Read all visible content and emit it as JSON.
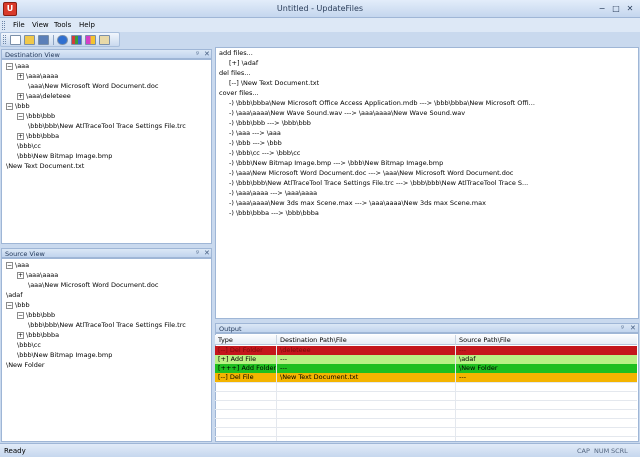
{
  "window": {
    "app_icon": "U",
    "title": "Untitled - UpdateFiles",
    "minimize": "−",
    "maximize": "□",
    "close": "✕"
  },
  "menu": {
    "items": [
      {
        "id": "file",
        "label": "File"
      },
      {
        "id": "view",
        "label": "View"
      },
      {
        "id": "tools",
        "label": "Tools"
      },
      {
        "id": "help",
        "label": "Help"
      }
    ]
  },
  "toolbar": {
    "buttons": [
      "new-icon",
      "open-icon",
      "save-icon",
      "help-icon",
      "grid-icon",
      "color-icon",
      "clipboard-icon"
    ]
  },
  "colors": {
    "red": "#c4161c",
    "green": "#1fbf1f",
    "light_green": "#b9f184",
    "orange": "#f4b400",
    "accent": "#c9d9ee"
  },
  "destination_view": {
    "title": "Destination View",
    "pin": "ᵍ",
    "close": "✕",
    "tree": [
      {
        "level": 0,
        "toggle": "−",
        "label": "\\aaa"
      },
      {
        "level": 1,
        "toggle": "+",
        "label": "\\aaa\\aaaa"
      },
      {
        "level": 2,
        "toggle": "",
        "label": "\\aaa\\New Microsoft Word Document.doc"
      },
      {
        "level": 1,
        "toggle": "+",
        "label": "\\aaa\\deleteee"
      },
      {
        "level": 0,
        "toggle": "−",
        "label": "\\bbb"
      },
      {
        "level": 1,
        "toggle": "−",
        "label": "\\bbb\\bbb"
      },
      {
        "level": 2,
        "toggle": "",
        "label": "\\bbb\\bbb\\New AtlTraceTool Trace Settings File.trc"
      },
      {
        "level": 1,
        "toggle": "+",
        "label": "\\bbb\\bbba"
      },
      {
        "level": 1,
        "toggle": "",
        "label": "\\bbb\\cc"
      },
      {
        "level": 1,
        "toggle": "",
        "label": "\\bbb\\New Bitmap Image.bmp"
      },
      {
        "level": 0,
        "toggle": "",
        "label": "\\New Text Document.txt"
      }
    ]
  },
  "source_view": {
    "title": "Source View",
    "pin": "ᵍ",
    "close": "✕",
    "tree": [
      {
        "level": 0,
        "toggle": "−",
        "label": "\\aaa"
      },
      {
        "level": 1,
        "toggle": "+",
        "label": "\\aaa\\aaaa"
      },
      {
        "level": 2,
        "toggle": "",
        "label": "\\aaa\\New Microsoft Word Document.doc"
      },
      {
        "level": 0,
        "toggle": "",
        "label": "\\adaf"
      },
      {
        "level": 0,
        "toggle": "−",
        "label": "\\bbb"
      },
      {
        "level": 1,
        "toggle": "−",
        "label": "\\bbb\\bbb"
      },
      {
        "level": 2,
        "toggle": "",
        "label": "\\bbb\\bbb\\New AtlTraceTool Trace Settings File.trc"
      },
      {
        "level": 1,
        "toggle": "+",
        "label": "\\bbb\\bbba"
      },
      {
        "level": 1,
        "toggle": "",
        "label": "\\bbb\\cc"
      },
      {
        "level": 1,
        "toggle": "",
        "label": "\\bbb\\New Bitmap Image.bmp"
      },
      {
        "level": 0,
        "toggle": "",
        "label": "\\New Folder"
      }
    ]
  },
  "log": {
    "lines": [
      {
        "indent": 0,
        "text": "add files..."
      },
      {
        "indent": 1,
        "text": "[+] \\adaf"
      },
      {
        "indent": 0,
        "text": "del files..."
      },
      {
        "indent": 1,
        "text": "[--] \\New Text Document.txt"
      },
      {
        "indent": 0,
        "text": "cover files..."
      },
      {
        "indent": 1,
        "text": "-) \\bbb\\bbba\\New Microsoft Office Access Application.mdb  ---> \\bbb\\bbba\\New Microsoft Offi..."
      },
      {
        "indent": 1,
        "text": "-) \\aaa\\aaaa\\New Wave Sound.wav  ---> \\aaa\\aaaa\\New Wave Sound.wav"
      },
      {
        "indent": 1,
        "text": "-) \\bbb\\bbb  ---> \\bbb\\bbb"
      },
      {
        "indent": 1,
        "text": "-) \\aaa  ---> \\aaa"
      },
      {
        "indent": 1,
        "text": "-) \\bbb  ---> \\bbb"
      },
      {
        "indent": 1,
        "text": "-) \\bbb\\cc  ---> \\bbb\\cc"
      },
      {
        "indent": 1,
        "text": "-) \\bbb\\New Bitmap Image.bmp  ---> \\bbb\\New Bitmap Image.bmp"
      },
      {
        "indent": 1,
        "text": "-) \\aaa\\New Microsoft Word Document.doc  ---> \\aaa\\New Microsoft Word Document.doc"
      },
      {
        "indent": 1,
        "text": "-) \\bbb\\bbb\\New AtlTraceTool Trace Settings File.trc  ---> \\bbb\\bbb\\New AtlTraceTool Trace S..."
      },
      {
        "indent": 1,
        "text": "-) \\aaa\\aaaa  ---> \\aaa\\aaaa"
      },
      {
        "indent": 1,
        "text": "-) \\aaa\\aaaa\\New 3ds max Scene.max  ---> \\aaa\\aaaa\\New 3ds max Scene.max"
      },
      {
        "indent": 1,
        "text": "-) \\bbb\\bbba  ---> \\bbb\\bbba"
      }
    ]
  },
  "output": {
    "title": "Output",
    "pin": "ᵍ",
    "close": "✕",
    "columns": [
      "Type",
      "Destination Path\\File",
      "Source Path\\File"
    ],
    "rows": [
      {
        "type": "[--] Del Folder",
        "dest": "\\deleteee",
        "src": "---",
        "color": "#c4161c"
      },
      {
        "type": "[+] Add File",
        "dest": "---",
        "src": "\\adaf",
        "color": "#b9f184"
      },
      {
        "type": "[+++] Add Folder",
        "dest": "---",
        "src": "\\New Folder",
        "color": "#1fbf1f"
      },
      {
        "type": "[--] Del File",
        "dest": "\\New Text Document.txt",
        "src": "---",
        "color": "#f4b400"
      }
    ]
  },
  "status": {
    "text": "Ready",
    "indicators": [
      "CAP",
      "NUM",
      "SCRL"
    ]
  }
}
